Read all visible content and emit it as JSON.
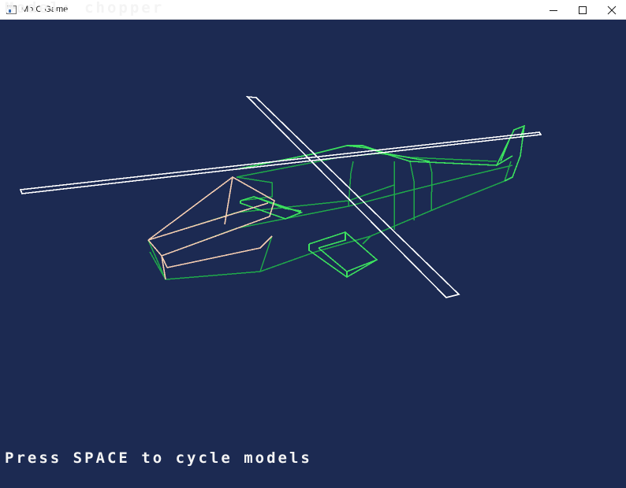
{
  "window": {
    "title": "MotC Game",
    "icon": "app-window-icon",
    "controls": [
      "minimize-icon",
      "maximize-icon",
      "close-icon"
    ]
  },
  "game": {
    "model_label": "Model: chopper",
    "hint": "Press SPACE to cycle models",
    "background_color": "#1c2a52",
    "model_colors": {
      "rotor": "#ffffff",
      "canopy": "#f2cbb0",
      "body_front": "#1fa84a",
      "body_back": "#3ce05e"
    }
  }
}
